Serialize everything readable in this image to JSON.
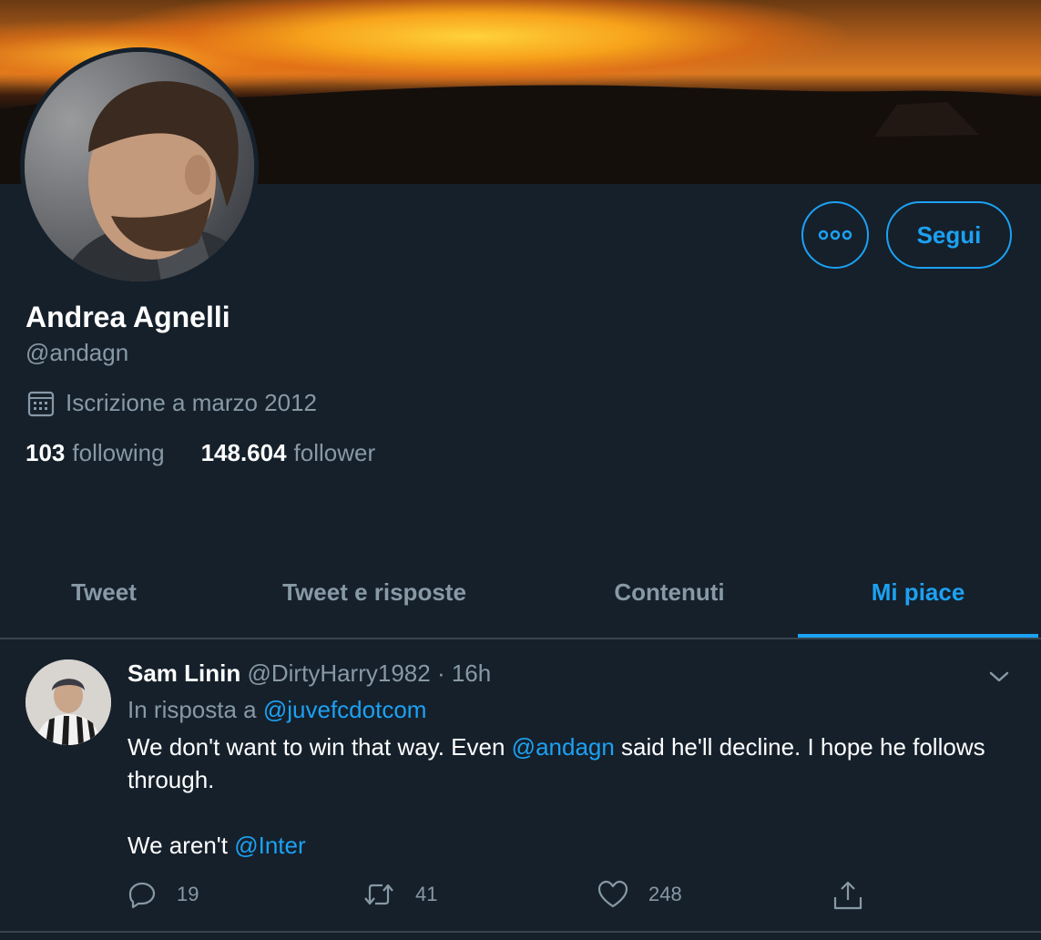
{
  "profile": {
    "name": "Andrea Agnelli",
    "handle": "@andagn",
    "joined": "Iscrizione a marzo 2012",
    "following_count": "103",
    "following_label": "following",
    "followers_count": "148.604",
    "followers_label": "follower",
    "follow_button": "Segui"
  },
  "tabs": [
    {
      "label": "Tweet"
    },
    {
      "label": "Tweet e risposte"
    },
    {
      "label": "Contenuti"
    },
    {
      "label": "Mi piace"
    }
  ],
  "active_tab": "Mi piace",
  "tweet": {
    "author_name": "Sam Linin",
    "author_handle": "@DirtyHarry1982",
    "separator": " · ",
    "time": "16h",
    "reply_prefix": "In risposta a ",
    "reply_to": "@juvefcdotcom",
    "text_part1": "We don't want to win that way. Even ",
    "mention1": "@andagn",
    "text_part2": " said he'll decline. I hope he follows through.",
    "text_part3": "We aren't ",
    "mention2": "@Inter",
    "replies": "19",
    "retweets": "41",
    "likes": "248"
  },
  "colors": {
    "background": "#15202b",
    "accent": "#1da1f2",
    "secondary_text": "#8899a6",
    "divider": "#38444d"
  },
  "icons": [
    "more-icon",
    "calendar-icon",
    "chevron-down-icon",
    "reply-icon",
    "retweet-icon",
    "like-icon",
    "share-icon"
  ]
}
